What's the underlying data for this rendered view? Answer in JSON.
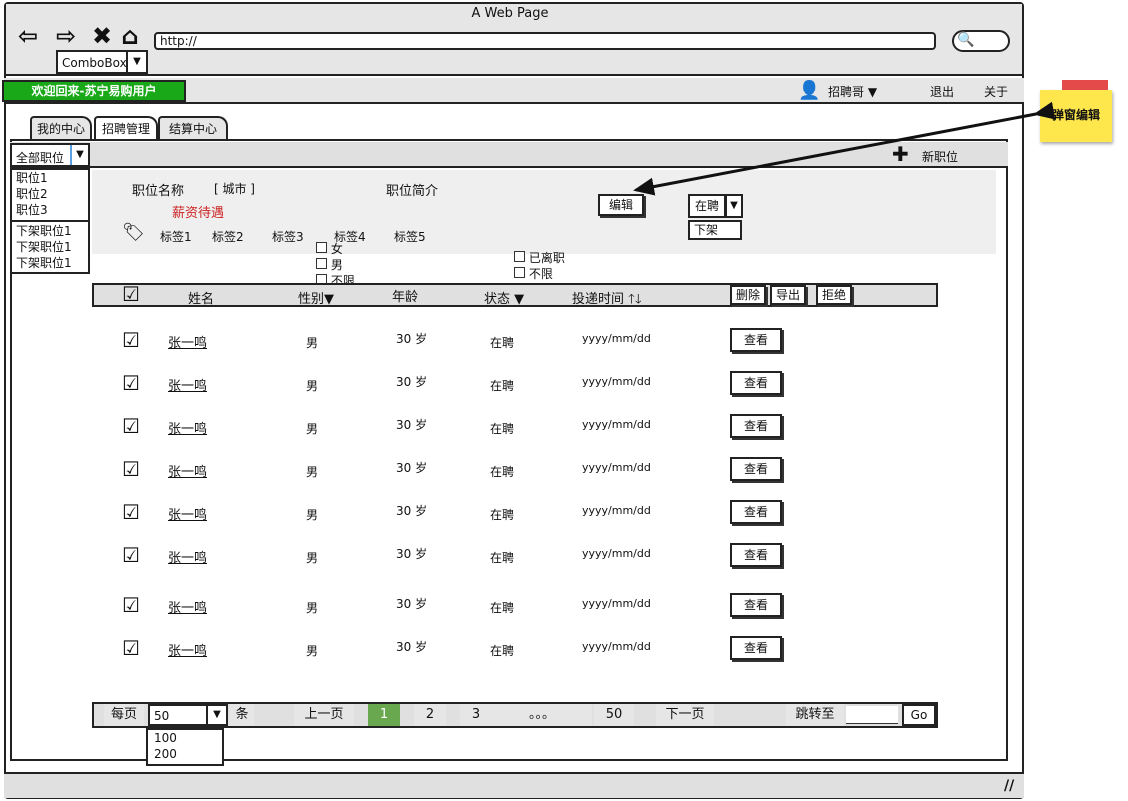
{
  "window": {
    "title": "A Web Page",
    "url": "http://",
    "combobox_label": "ComboBox"
  },
  "icons": {
    "back": "back-arrow-icon",
    "forward": "forward-arrow-icon",
    "stop": "close-icon",
    "home": "home-icon",
    "search": "search-icon",
    "user": "user-icon",
    "tag": "tag-icon",
    "plus": "plus-icon"
  },
  "menubar": {
    "welcome": "欢迎回来-苏宁易购用户",
    "user": "招聘哥",
    "logout": "退出",
    "about": "关于"
  },
  "tabs": [
    "我的中心",
    "招聘管理",
    "结算中心"
  ],
  "filter": {
    "selected": "全部职位",
    "options": [
      "职位1",
      "职位2",
      "职位3"
    ],
    "offline_options": [
      "下架职位1",
      "下架职位1",
      "下架职位1"
    ],
    "new_position": "新职位"
  },
  "job": {
    "name": "职位名称",
    "city": "[ 城市 ]",
    "intro": "职位简介",
    "salary": "薪资待遇",
    "edit": "编辑",
    "status": "在聘",
    "offline": "下架",
    "tags": [
      "标签1",
      "标签2",
      "标签3",
      "标签4",
      "标签5"
    ],
    "gender_options": [
      "女",
      "男",
      "不限"
    ],
    "status_options": [
      "已离职",
      "不限"
    ]
  },
  "table": {
    "headers": {
      "name": "姓名",
      "gender": "性别",
      "age": "年龄",
      "status": "状态",
      "time": "投递时间"
    },
    "actions": {
      "delete": "删除",
      "export": "导出",
      "reject": "拒绝"
    },
    "view_label": "查看",
    "rows": [
      {
        "name": "张一鸣",
        "gender": "男",
        "age": "30 岁",
        "status": "在聘",
        "time": "yyyy/mm/dd"
      },
      {
        "name": "张一鸣",
        "gender": "男",
        "age": "30 岁",
        "status": "在聘",
        "time": "yyyy/mm/dd"
      },
      {
        "name": "张一鸣",
        "gender": "男",
        "age": "30 岁",
        "status": "在聘",
        "time": "yyyy/mm/dd"
      },
      {
        "name": "张一鸣",
        "gender": "男",
        "age": "30 岁",
        "status": "在聘",
        "time": "yyyy/mm/dd"
      },
      {
        "name": "张一鸣",
        "gender": "男",
        "age": "30 岁",
        "status": "在聘",
        "time": "yyyy/mm/dd"
      },
      {
        "name": "张一鸣",
        "gender": "男",
        "age": "30 岁",
        "status": "在聘",
        "time": "yyyy/mm/dd"
      },
      {
        "name": "张一鸣",
        "gender": "男",
        "age": "30 岁",
        "status": "在聘",
        "time": "yyyy/mm/dd"
      },
      {
        "name": "张一鸣",
        "gender": "男",
        "age": "30 岁",
        "status": "在聘",
        "time": "yyyy/mm/dd"
      }
    ]
  },
  "pager": {
    "per_page_label": "每页",
    "per_page": "50",
    "per_page_options": [
      "100",
      "200"
    ],
    "unit": "条",
    "prev": "上一页",
    "pages": [
      "1",
      "2",
      "3"
    ],
    "ellipsis": "。。。",
    "last": "50",
    "next": "下一页",
    "jump_label": "跳转至",
    "go": "Go"
  },
  "annotation": {
    "note": "弹窗编辑"
  },
  "colors": {
    "welcome_bg": "#18a818",
    "active_page": "#6aa84f",
    "salary": "#cc2222",
    "note": "#fde74c"
  }
}
